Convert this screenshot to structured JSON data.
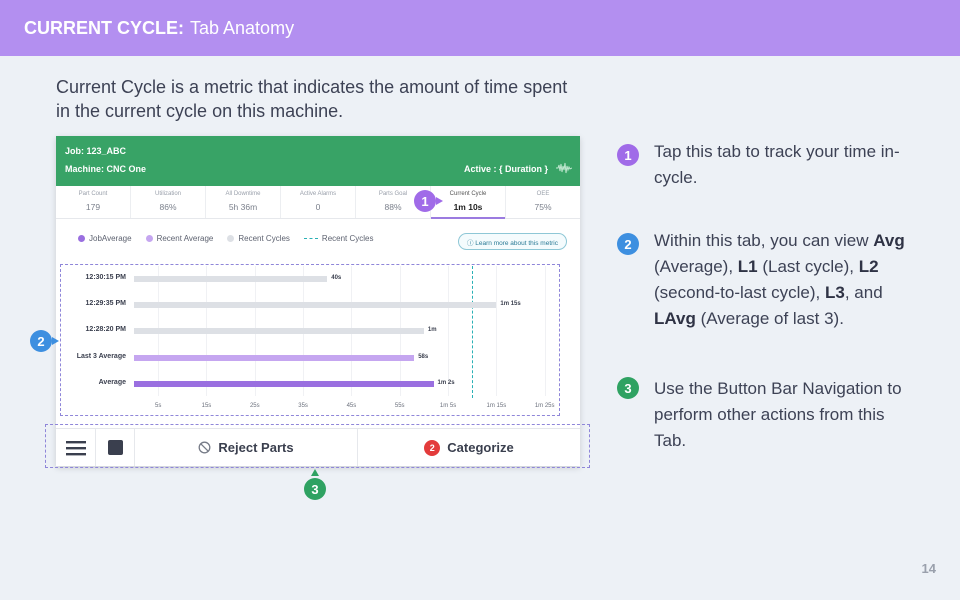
{
  "header": {
    "title_bold": "CURRENT CYCLE:",
    "title_rest": "Tab Anatomy"
  },
  "intro": "Current Cycle is a metric that indicates the amount of time spent in the current cycle on this machine.",
  "app": {
    "job": "Job: 123_ABC",
    "machine": "Machine: CNC One",
    "active": "Active : { Duration }",
    "tabs": [
      {
        "label": "Part Count",
        "value": "179"
      },
      {
        "label": "Utilization",
        "value": "86%"
      },
      {
        "label": "All Downtime",
        "value": "5h 36m"
      },
      {
        "label": "Active Alarms",
        "value": "0"
      },
      {
        "label": "Parts Goal",
        "value": "88%"
      },
      {
        "label": "Current Cycle",
        "value": "1m 10s"
      },
      {
        "label": "OEE",
        "value": "75%"
      }
    ],
    "legend": [
      "JobAverage",
      "Recent Average",
      "Recent Cycles",
      "Recent Cycles"
    ],
    "learn_more": "ⓘ Learn more about this metric",
    "button_bar": {
      "reject": "Reject Parts",
      "categorize": "Categorize",
      "categorize_badge": "2"
    }
  },
  "chart_data": {
    "type": "bar",
    "orientation": "horizontal",
    "categories": [
      "12:30:15 PM",
      "12:29:35 PM",
      "12:28:20 PM",
      "Last 3 Average",
      "Average"
    ],
    "values": [
      40,
      75,
      60,
      58,
      62
    ],
    "value_labels": [
      "40s",
      "1m 15s",
      "1m",
      "58s",
      "1m 2s"
    ],
    "x_ticks": [
      "5s",
      "15s",
      "25s",
      "35s",
      "45s",
      "55s",
      "1m 5s",
      "1m 15s",
      "1m 25s"
    ],
    "x_tick_values": [
      5,
      15,
      25,
      35,
      45,
      55,
      65,
      75,
      85
    ],
    "xlim": [
      0,
      89
    ],
    "reference_line": 70,
    "colors": [
      "#dde0e5",
      "#dde0e5",
      "#dde0e5",
      "#c5a6f0",
      "#9a6fe0"
    ],
    "reference_color": "#2ab0b5"
  },
  "callouts": {
    "c1": "1",
    "c2": "2",
    "c3": "3"
  },
  "notes": {
    "n1": "Tap this tab to track your time in-cycle.",
    "n2": {
      "b1": "Avg",
      "t1": " (Average), ",
      "b2": "L1",
      "t2": " (Last cycle), ",
      "b3": "L2",
      "t3": " (second-to-last cycle), ",
      "b4": "L3",
      "t4": ", and ",
      "b5": "LAvg",
      "t5": " (Average of last 3).",
      "prefix": "Within this tab, you can view "
    },
    "n3": "Use the Button Bar Navigation to perform other actions from this Tab."
  },
  "page_number": "14",
  "colors": {
    "header": "#b38ff0",
    "app_header": "#38a366",
    "purple": "#a06be8",
    "blue": "#3d8fe0",
    "green": "#2fa262"
  }
}
